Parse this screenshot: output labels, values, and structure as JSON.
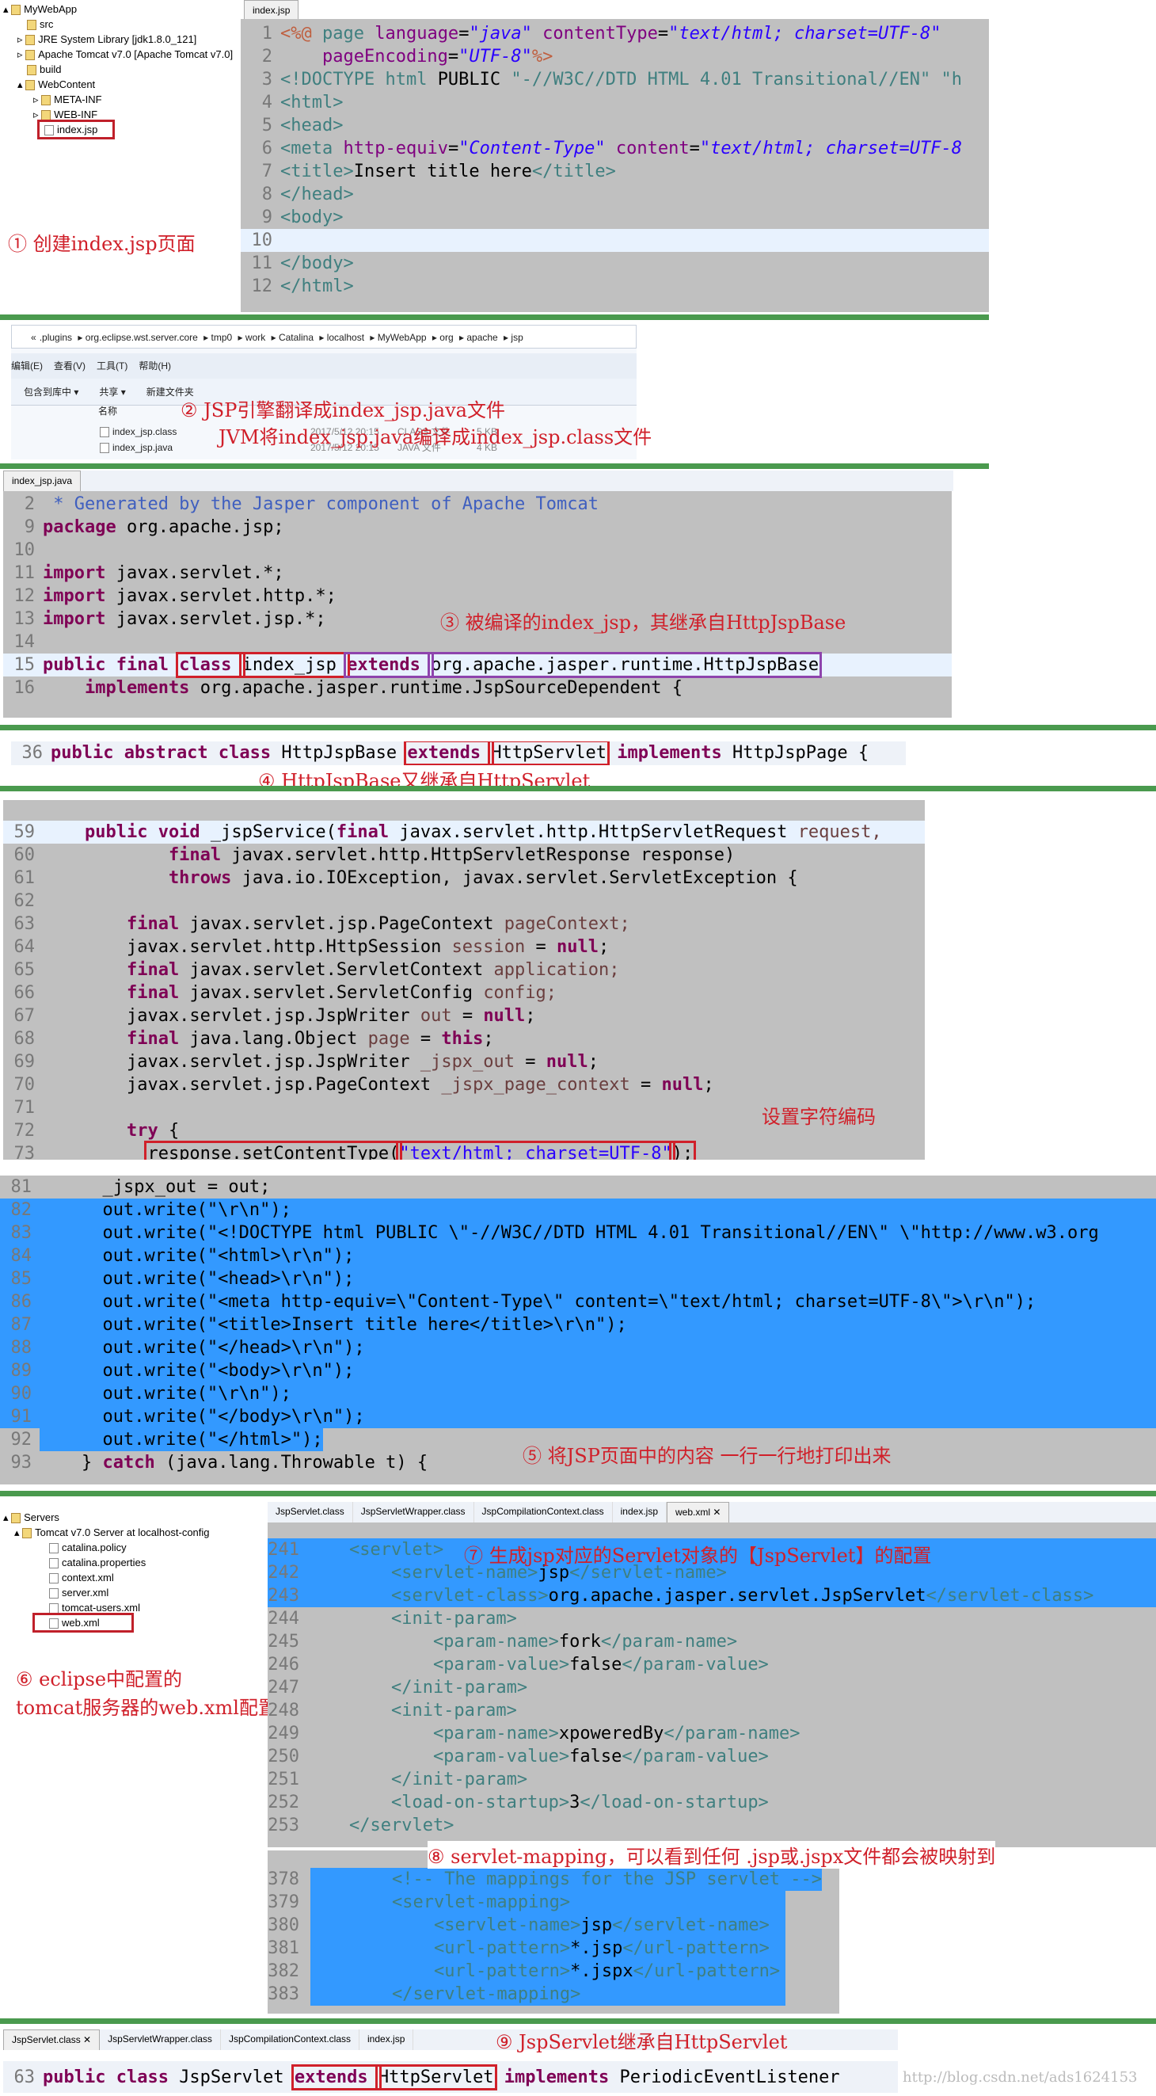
{
  "s1": {
    "tree": [
      "MyWebApp",
      "src",
      "JRE System Library [jdk1.8.0_121]",
      "Apache Tomcat v7.0 [Apache Tomcat v7.0]",
      "build",
      "WebContent",
      "META-INF",
      "WEB-INF",
      "index.jsp"
    ],
    "tab": "index.jsp",
    "note": "① 创建index.jsp页面",
    "lines": [
      {
        "n": "1",
        "s": [
          [
            "<%@ ",
            "dir"
          ],
          [
            "page ",
            "tag"
          ],
          [
            "language",
            "attr"
          ],
          [
            "=",
            ""
          ],
          [
            "\"java\" ",
            "stri"
          ],
          [
            "contentType",
            "attr"
          ],
          [
            "=",
            ""
          ],
          [
            "\"text/html; charset=UTF-8\"",
            "stri"
          ]
        ]
      },
      {
        "n": "2",
        "s": [
          [
            "    pageEncoding",
            "attr"
          ],
          [
            "=",
            ""
          ],
          [
            "\"UTF-8\"",
            "stri"
          ],
          [
            "%>",
            "dir"
          ]
        ]
      },
      {
        "n": "3",
        "s": [
          [
            "<!DOCTYPE ",
            "tag"
          ],
          [
            "html ",
            "tag"
          ],
          [
            "PUBLIC ",
            ""
          ],
          [
            "\"-//W3C//DTD HTML 4.01 Transitional//EN\" \"h",
            "tag"
          ]
        ]
      },
      {
        "n": "4",
        "s": [
          [
            "<html>",
            "tag"
          ]
        ]
      },
      {
        "n": "5",
        "s": [
          [
            "<head>",
            "tag"
          ]
        ]
      },
      {
        "n": "6",
        "s": [
          [
            "<meta ",
            "tag"
          ],
          [
            "http-equiv",
            "attr"
          ],
          [
            "=",
            ""
          ],
          [
            "\"Content-Type\" ",
            "stri"
          ],
          [
            "content",
            "attr"
          ],
          [
            "=",
            ""
          ],
          [
            "\"text/html; charset=UTF-8",
            "stri"
          ]
        ]
      },
      {
        "n": "7",
        "s": [
          [
            "<title>",
            "tag"
          ],
          [
            "Insert title here",
            ""
          ],
          [
            "</title>",
            "tag"
          ]
        ]
      },
      {
        "n": "8",
        "s": [
          [
            "</head>",
            "tag"
          ]
        ]
      },
      {
        "n": "9",
        "s": [
          [
            "<body>",
            "tag"
          ]
        ]
      },
      {
        "n": "10",
        "s": [],
        "hl": "cur"
      },
      {
        "n": "11",
        "s": [
          [
            "</body>",
            "tag"
          ]
        ]
      },
      {
        "n": "12",
        "s": [
          [
            "</html>",
            "tag"
          ]
        ]
      }
    ]
  },
  "s2": {
    "path": [
      "«",
      ".plugins",
      "org.eclipse.wst.server.core",
      "tmp0",
      "work",
      "Catalina",
      "localhost",
      "MyWebApp",
      "org",
      "apache",
      "jsp"
    ],
    "menu": [
      "编辑(E)",
      "查看(V)",
      "工具(T)",
      "帮助(H)"
    ],
    "toolbar": [
      "包含到库中 ▾",
      "共享 ▾",
      "新建文件夹"
    ],
    "col": "名称",
    "files": [
      {
        "name": "index_jsp.class",
        "date": "2017/5/12 20:15",
        "type": "CLASS 文件",
        "size": "5 KB"
      },
      {
        "name": "index_jsp.java",
        "date": "2017/5/12 20:15",
        "type": "JAVA 文件",
        "size": "4 KB"
      }
    ],
    "note1": "② JSP引擎翻译成index_jsp.java文件",
    "note2": "JVM将index_jsp.java编译成index_jsp.class文件"
  },
  "s3": {
    "tab": "index_jsp.java",
    "note": "③ 被编译的index_jsp，其继承自HttpJspBase",
    "lines": [
      {
        "n": "2",
        "s": [
          [
            " * Generated by the Jasper component of Apache Tomcat",
            "cmt"
          ]
        ]
      },
      {
        "n": "9",
        "s": [
          [
            "package ",
            "kw"
          ],
          [
            "org.apache.jsp;",
            ""
          ]
        ]
      },
      {
        "n": "10",
        "s": []
      },
      {
        "n": "11",
        "s": [
          [
            "import ",
            "kw"
          ],
          [
            "javax.servlet.*;",
            ""
          ]
        ]
      },
      {
        "n": "12",
        "s": [
          [
            "import ",
            "kw"
          ],
          [
            "javax.servlet.http.*;",
            ""
          ]
        ]
      },
      {
        "n": "13",
        "s": [
          [
            "import ",
            "kw"
          ],
          [
            "javax.servlet.jsp.*;",
            ""
          ]
        ]
      },
      {
        "n": "14",
        "s": []
      },
      {
        "n": "15",
        "s": [
          [
            "public final ",
            "kw"
          ],
          [
            "class ",
            "kw box"
          ],
          [
            "index_jsp ",
            "box"
          ],
          [
            "extends ",
            "kw pbox"
          ],
          [
            "org.apache.jasper.runtime.HttpJspBase",
            "pbox"
          ]
        ],
        "hl": "cur"
      },
      {
        "n": "16",
        "s": [
          [
            "    implements ",
            "kw"
          ],
          [
            "org.apache.jasper.runtime.JspSourceDependent {",
            ""
          ]
        ]
      }
    ]
  },
  "s4": {
    "note": "④ HttpJspBase又继承自HttpServlet",
    "lines": [
      {
        "n": "36",
        "s": [
          [
            "public abstract class ",
            "kw"
          ],
          [
            "HttpJspBase ",
            ""
          ],
          [
            "extends ",
            "kw box"
          ],
          [
            "HttpServlet",
            "box"
          ],
          [
            " implements ",
            "kw"
          ],
          [
            "HttpJspPage {",
            ""
          ]
        ]
      }
    ]
  },
  "s5": {
    "note": "设置字符编码",
    "lines": [
      {
        "n": "59",
        "s": [
          [
            "    public void ",
            "kw"
          ],
          [
            "_jspService(",
            "",
            ""
          ],
          [
            "final ",
            "kw"
          ],
          [
            "javax.servlet.http.HttpServletRequest ",
            ""
          ],
          [
            "request,",
            "var"
          ]
        ],
        "hl": "cur"
      },
      {
        "n": "60",
        "s": [
          [
            "            final ",
            "kw"
          ],
          [
            "javax.servlet.http.HttpServletResponse ",
            ""
          ],
          [
            "response",
            ""
          ],
          [
            ")",
            ""
          ]
        ]
      },
      {
        "n": "61",
        "s": [
          [
            "            throws ",
            "kw"
          ],
          [
            "java.io.IOException, javax.servlet.ServletException {",
            ""
          ]
        ]
      },
      {
        "n": "62",
        "s": []
      },
      {
        "n": "63",
        "s": [
          [
            "        final ",
            "kw"
          ],
          [
            "javax.servlet.jsp.PageContext ",
            ""
          ],
          [
            "pageContext;",
            "var"
          ]
        ]
      },
      {
        "n": "64",
        "s": [
          [
            "        javax.servlet.http.HttpSession ",
            ""
          ],
          [
            "session ",
            "var"
          ],
          [
            "= ",
            ""
          ],
          [
            "null",
            "kw"
          ],
          [
            ";",
            ""
          ]
        ]
      },
      {
        "n": "65",
        "s": [
          [
            "        final ",
            "kw"
          ],
          [
            "javax.servlet.ServletContext ",
            ""
          ],
          [
            "application;",
            "var"
          ]
        ]
      },
      {
        "n": "66",
        "s": [
          [
            "        final ",
            "kw"
          ],
          [
            "javax.servlet.ServletConfig ",
            ""
          ],
          [
            "config;",
            "var"
          ]
        ]
      },
      {
        "n": "67",
        "s": [
          [
            "        javax.servlet.jsp.JspWriter ",
            ""
          ],
          [
            "out ",
            "var"
          ],
          [
            "= ",
            ""
          ],
          [
            "null",
            "kw"
          ],
          [
            ";",
            ""
          ]
        ]
      },
      {
        "n": "68",
        "s": [
          [
            "        final ",
            "kw"
          ],
          [
            "java.lang.Object ",
            ""
          ],
          [
            "page ",
            "var"
          ],
          [
            "= ",
            ""
          ],
          [
            "this",
            "kw"
          ],
          [
            ";",
            ""
          ]
        ]
      },
      {
        "n": "69",
        "s": [
          [
            "        javax.servlet.jsp.JspWriter ",
            ""
          ],
          [
            "_jspx_out ",
            "var"
          ],
          [
            "= ",
            ""
          ],
          [
            "null",
            "kw"
          ],
          [
            ";",
            ""
          ]
        ]
      },
      {
        "n": "70",
        "s": [
          [
            "        javax.servlet.jsp.PageContext ",
            ""
          ],
          [
            "_jspx_page_context ",
            "var"
          ],
          [
            "= ",
            ""
          ],
          [
            "null",
            "kw"
          ],
          [
            ";",
            ""
          ]
        ]
      },
      {
        "n": "71",
        "s": []
      },
      {
        "n": "72",
        "s": [
          [
            "        try ",
            "kw"
          ],
          [
            "{",
            ""
          ]
        ]
      },
      {
        "n": "73",
        "s": [
          [
            "          ",
            ""
          ],
          [
            "response.setContentType(",
            "box"
          ],
          [
            "\"text/html; charset=UTF-8\"",
            "str box"
          ],
          [
            ");",
            "box"
          ]
        ]
      }
    ]
  },
  "s6": {
    "note": "⑤ 将JSP页面中的内容  一行一行地打印出来",
    "lines": [
      {
        "n": "81",
        "s": [
          [
            "      _jspx_out = out;",
            ""
          ]
        ]
      },
      {
        "n": "82",
        "s": [
          [
            "      out.write(\"\\r\\n\");",
            ""
          ]
        ],
        "hl": "full"
      },
      {
        "n": "83",
        "s": [
          [
            "      out.write(\"<!DOCTYPE html PUBLIC \\\"-//W3C//DTD HTML 4.01 Transitional//EN\\\" \\\"http://www.w3.org",
            ""
          ]
        ],
        "hl": "full"
      },
      {
        "n": "84",
        "s": [
          [
            "      out.write(\"<html>\\r\\n\");",
            ""
          ]
        ],
        "hl": "full"
      },
      {
        "n": "85",
        "s": [
          [
            "      out.write(\"<head>\\r\\n\");",
            ""
          ]
        ],
        "hl": "full"
      },
      {
        "n": "86",
        "s": [
          [
            "      out.write(\"<meta http-equiv=\\\"Content-Type\\\" content=\\\"text/html; charset=UTF-8\\\">\\r\\n\");",
            ""
          ]
        ],
        "hl": "full"
      },
      {
        "n": "87",
        "s": [
          [
            "      out.write(\"<title>Insert title here</title>\\r\\n\");",
            ""
          ]
        ],
        "hl": "full"
      },
      {
        "n": "88",
        "s": [
          [
            "      out.write(\"</head>\\r\\n\");",
            ""
          ]
        ],
        "hl": "full"
      },
      {
        "n": "89",
        "s": [
          [
            "      out.write(\"<body>\\r\\n\");",
            ""
          ]
        ],
        "hl": "full"
      },
      {
        "n": "90",
        "s": [
          [
            "      out.write(\"\\r\\n\");",
            ""
          ]
        ],
        "hl": "full"
      },
      {
        "n": "91",
        "s": [
          [
            "      out.write(\"</body>\\r\\n\");",
            ""
          ]
        ],
        "hl": "full"
      },
      {
        "n": "92",
        "s": [
          [
            "      out.write(\"</html>\");",
            ""
          ]
        ],
        "hl": "sel"
      },
      {
        "n": "93",
        "s": [
          [
            "    } ",
            ""
          ],
          [
            "catch ",
            "kw"
          ],
          [
            "(java.lang.Throwable t) {",
            ""
          ]
        ]
      }
    ]
  },
  "s7": {
    "tree": [
      "Servers",
      "Tomcat v7.0 Server at localhost-config",
      "catalina.policy",
      "catalina.properties",
      "context.xml",
      "server.xml",
      "tomcat-users.xml",
      "web.xml"
    ],
    "tabs": [
      "JspServlet.class",
      "JspServletWrapper.class",
      "JspCompilationContext.class",
      "index.jsp",
      "web.xml ✕"
    ],
    "note6a": "⑥ eclipse中配置的",
    "note6b": "tomcat服务器的web.xml配置文件",
    "note7": "⑦ 生成jsp对应的Servlet对象的【JspServlet】的配置",
    "note8": "⑧ servlet-mapping，可以看到任何 .jsp或.jspx文件都会被映射到",
    "lines": [
      {
        "n": "241",
        "s": [
          [
            "    <servlet>",
            "tag"
          ]
        ],
        "hl": "full"
      },
      {
        "n": "242",
        "s": [
          [
            "        <servlet-name>",
            "tag"
          ],
          [
            "jsp",
            ""
          ],
          [
            "</servlet-name>",
            "tag"
          ]
        ],
        "hl": "full"
      },
      {
        "n": "243",
        "s": [
          [
            "        <servlet-class>",
            "tag"
          ],
          [
            "org.apache.jasper.servlet.JspServlet",
            ""
          ],
          [
            "</servlet-class>",
            "tag"
          ]
        ],
        "hl": "full"
      },
      {
        "n": "244",
        "s": [
          [
            "        <init-param>",
            "tag"
          ]
        ]
      },
      {
        "n": "245",
        "s": [
          [
            "            <param-name>",
            "tag"
          ],
          [
            "fork",
            ""
          ],
          [
            "</param-name>",
            "tag"
          ]
        ]
      },
      {
        "n": "246",
        "s": [
          [
            "            <param-value>",
            "tag"
          ],
          [
            "false",
            ""
          ],
          [
            "</param-value>",
            "tag"
          ]
        ]
      },
      {
        "n": "247",
        "s": [
          [
            "        </init-param>",
            "tag"
          ]
        ]
      },
      {
        "n": "248",
        "s": [
          [
            "        <init-param>",
            "tag"
          ]
        ]
      },
      {
        "n": "249",
        "s": [
          [
            "            <param-name>",
            "tag"
          ],
          [
            "xpoweredBy",
            ""
          ],
          [
            "</param-name>",
            "tag"
          ]
        ]
      },
      {
        "n": "250",
        "s": [
          [
            "            <param-value>",
            "tag"
          ],
          [
            "false",
            ""
          ],
          [
            "</param-value>",
            "tag"
          ]
        ]
      },
      {
        "n": "251",
        "s": [
          [
            "        </init-param>",
            "tag"
          ]
        ]
      },
      {
        "n": "252",
        "s": [
          [
            "        <load-on-startup>",
            "tag"
          ],
          [
            "3",
            ""
          ],
          [
            "</load-on-startup>",
            "tag"
          ]
        ]
      },
      {
        "n": "253",
        "s": [
          [
            "    </servlet>",
            "tag"
          ]
        ]
      }
    ],
    "lines2": [
      {
        "n": "378",
        "s": [
          [
            "    <!-- The mappings for the JSP servlet -->",
            "tag"
          ]
        ],
        "hl": "sel"
      },
      {
        "n": "379",
        "s": [
          [
            "    <servlet-mapping>",
            "tag"
          ]
        ],
        "hl": "sel"
      },
      {
        "n": "380",
        "s": [
          [
            "        <servlet-name>",
            "tag"
          ],
          [
            "jsp",
            ""
          ],
          [
            "</servlet-name>",
            "tag"
          ]
        ],
        "hl": "sel"
      },
      {
        "n": "381",
        "s": [
          [
            "        <url-pattern>",
            "tag"
          ],
          [
            "*.jsp",
            ""
          ],
          [
            "</url-pattern>",
            "tag"
          ]
        ],
        "hl": "sel"
      },
      {
        "n": "382",
        "s": [
          [
            "        <url-pattern>",
            "tag"
          ],
          [
            "*.jspx",
            ""
          ],
          [
            "</url-pattern>",
            "tag"
          ]
        ],
        "hl": "sel"
      },
      {
        "n": "383",
        "s": [
          [
            "    </servlet-mapping>",
            "tag"
          ]
        ],
        "hl": "sel"
      }
    ]
  },
  "s8": {
    "tabs": [
      "JspServlet.class ✕",
      "JspServletWrapper.class",
      "JspCompilationContext.class",
      "index.jsp"
    ],
    "note": "⑨ JspServlet继承自HttpServlet",
    "lines": [
      {
        "n": "63",
        "s": [
          [
            "public class ",
            "kw"
          ],
          [
            "JspServlet ",
            ""
          ],
          [
            "extends ",
            "kw box"
          ],
          [
            "HttpServlet",
            "box"
          ],
          [
            " implements ",
            "kw"
          ],
          [
            "PeriodicEventListener",
            ""
          ]
        ]
      }
    ],
    "watermark": "http://blog.csdn.net/ads1624153"
  },
  "colors": {
    "annotation": "#d0202a",
    "divider": "#4a9a4e",
    "selection": "#3399ff",
    "editor_bg": "#c0c0c0"
  }
}
